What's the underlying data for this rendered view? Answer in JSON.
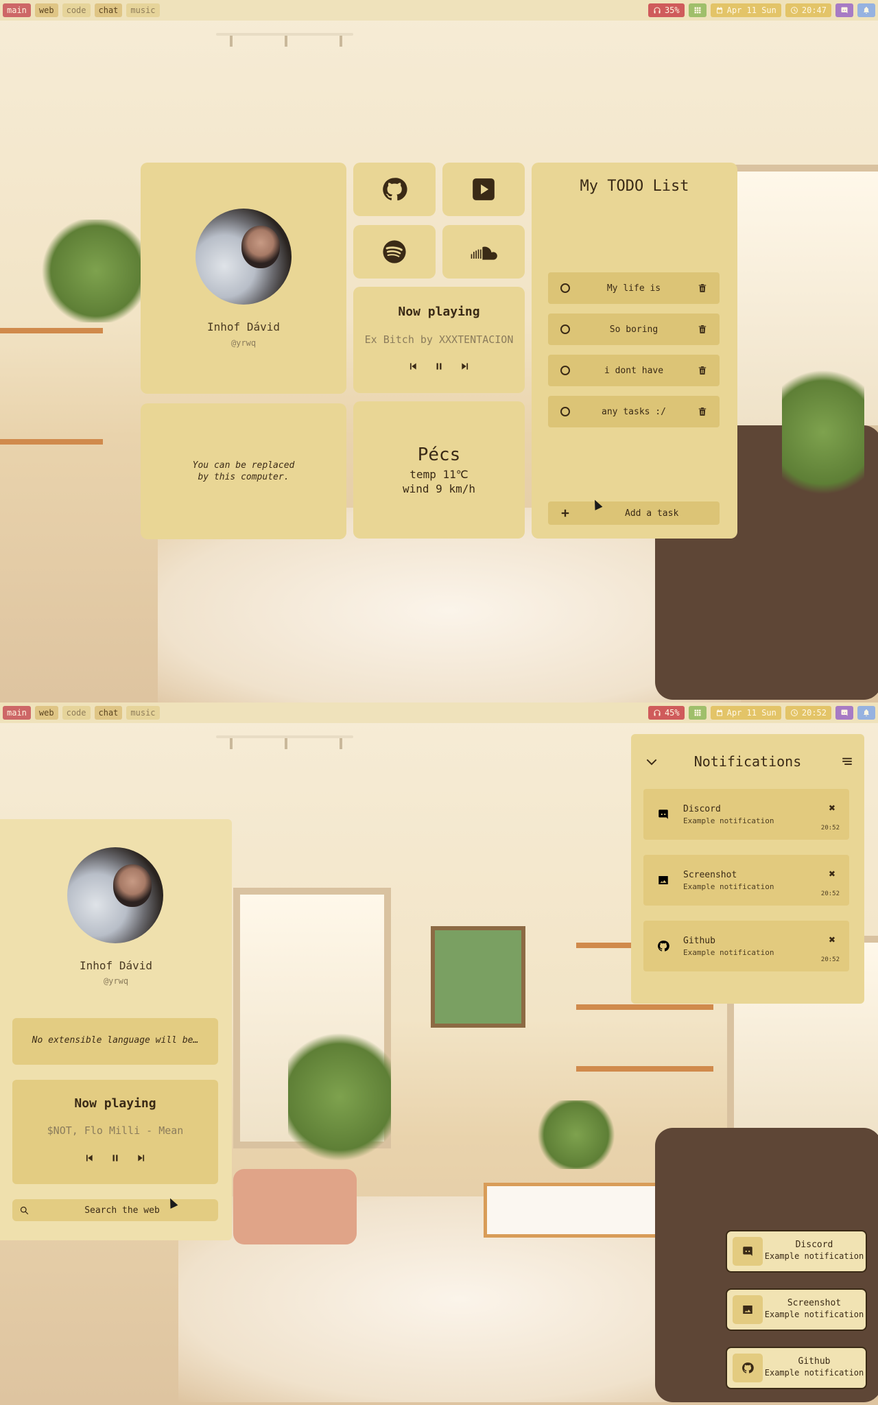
{
  "screen1": {
    "workspaces": [
      "main",
      "web",
      "code",
      "chat",
      "music"
    ],
    "status": {
      "volume": "35%",
      "date": "Apr 11 Sun",
      "time": "20:47"
    },
    "profile": {
      "name": "Inhof Dávid",
      "handle": "@yrwq"
    },
    "quote": "You can be replaced\nby this computer.",
    "now_playing": {
      "title": "Now playing",
      "track": "Ex Bitch by XXXTENTACION"
    },
    "weather": {
      "city": "Pécs",
      "temp": "temp 11℃",
      "wind": "wind 9 km/h"
    },
    "todo": {
      "title": "My TODO List",
      "tasks": [
        "My life is",
        "So boring",
        "i dont have",
        "any tasks :/"
      ],
      "add_label": "Add a task"
    },
    "apps": [
      "github-icon",
      "youtube-icon",
      "spotify-icon",
      "soundcloud-icon"
    ]
  },
  "screen2": {
    "workspaces": [
      "main",
      "web",
      "code",
      "chat",
      "music"
    ],
    "status": {
      "volume": "45%",
      "date": "Apr 11 Sun",
      "time": "20:52"
    },
    "profile": {
      "name": "Inhof Dávid",
      "handle": "@yrwq"
    },
    "quote": "No extensible language will be…",
    "now_playing": {
      "title": "Now playing",
      "track": "$NOT, Flo Milli - Mean"
    },
    "search_placeholder": "Search the web",
    "notifications": {
      "title": "Notifications",
      "items": [
        {
          "app": "Discord",
          "body": "Example notification",
          "time": "20:52",
          "icon": "discord-icon"
        },
        {
          "app": "Screenshot",
          "body": "Example notification",
          "time": "20:52",
          "icon": "image-icon"
        },
        {
          "app": "Github",
          "body": "Example notification",
          "time": "20:52",
          "icon": "github-icon"
        }
      ]
    },
    "toasts": [
      {
        "app": "Discord",
        "body": "Example notification",
        "icon": "discord-icon"
      },
      {
        "app": "Screenshot",
        "body": "Example notification",
        "icon": "image-icon"
      },
      {
        "app": "Github",
        "body": "Example notification",
        "icon": "github-icon"
      }
    ]
  }
}
